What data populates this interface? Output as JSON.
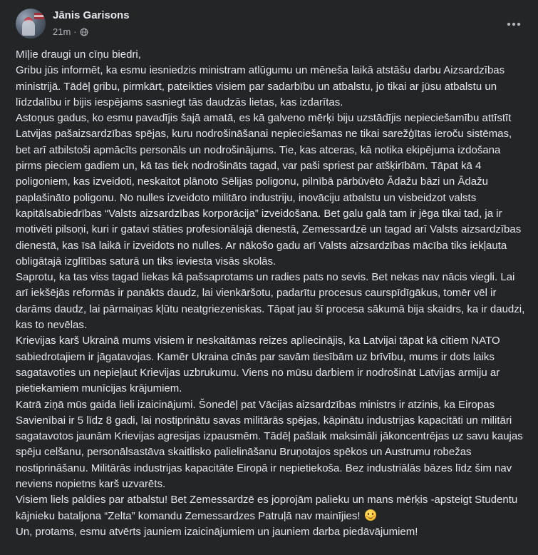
{
  "author": {
    "name": "Jānis Garisons",
    "time": "21m",
    "separator": "·",
    "audience_icon": "globe-icon"
  },
  "menu": {
    "icon": "more-horizontal-icon"
  },
  "post": {
    "lines": [
      "Mīļie draugi un cīņu biedri,",
      "Gribu jūs informēt, ka esmu iesniedzis ministram atlūgumu un mēneša laikā atstāšu darbu Aizsardzības ministrijā. Tādēļ gribu, pirmkārt, pateikties visiem par sadarbību un atbalstu, jo tikai ar jūsu atbalstu un līdzdalību ir bijis iespējams sasniegt tās daudzās lietas, kas izdarītas.",
      "Astoņus gadus, ko esmu pavadījis šajā amatā, es kā galveno mērķi biju uzstādījis nepieciešamību attīstīt Latvijas pašaizsardzības spējas, kuru nodrošināšanai nepieciešamas ne tikai sarežģītas ieroču sistēmas, bet arī atbilstoši apmācīts personāls un nodrošinājums. Tie, kas atceras, kā notika ekipējuma izdošana pirms pieciem gadiem un, kā tas tiek nodrošināts tagad, var paši spriest par atšķirībām. Tāpat kā 4 poligoniem, kas izveidoti, neskaitot plānoto Sēlijas poligonu, pilnībā pārbūvēto Ādažu bāzi un Ādažu paplašināto poligonu. No nulles izveidoto militāro industriju, inovāciju atbalstu un visbeidzot valsts kapitālsabiedrības “Valsts aizsardzības korporācija” izveidošana. Bet galu galā tam ir jēga tikai tad, ja ir motivēti pilsoņi, kuri ir gatavi stāties profesionālajā dienestā, Zemessardzē un tagad arī Valsts aizsardzības dienestā, kas īsā laikā ir izveidots no nulles. Ar nākošo gadu arī Valsts aizsardzības mācība tiks iekļauta obligātajā izglītības saturā un tiks ieviesta visās skolās.",
      "Saprotu, ka tas viss tagad liekas kā pašsaprotams un radies pats no sevis. Bet nekas nav nācis viegli. Lai arī iekšējās reformās ir panākts daudz, lai vienkāršotu, padarītu procesus caurspīdīgākus, tomēr vēl ir darāms daudz, lai pārmaiņas kļūtu neatgriezeniskas. Tāpat jau šī procesa sākumā bija skaidrs, ka ir daudzi, kas to nevēlas.",
      "Krievijas karš Ukrainā mums visiem ir neskaitāmas reizes apliecinājis, ka Latvijai tāpat kā citiem NATO sabiedrotajiem ir jāgatavojas. Kamēr Ukraina cīnās par savām tiesībām uz brīvību, mums ir dots laiks sagatavoties un nepieļaut Krievijas uzbrukumu. Viens no mūsu darbiem ir nodrošināt Latvijas armiju ar pietiekamiem munīcijas krājumiem.",
      "Katrā ziņā mūs gaida lieli izaicinājumi. Šonedēļ pat Vācijas aizsardzības ministrs ir atzinis, ka Eiropas Savienībai ir 5 līdz 8 gadi, lai nostiprinātu savas militārās spējas, kāpinātu industrijas kapacitāti un militāri sagatavotos jaunām Krievijas agresijas izpausmēm. Tādēļ pašlaik maksimāli jākoncentrējas uz savu kaujas spēju celšanu, personālsastāva skaitlisko palielināšanu Bruņotajos spēkos un Austrumu robežas nostiprināšanu. Militārās industrijas kapacitāte Eiropā ir nepietiekoša. Bez industriālās bāzes līdz šim nav neviens nopietns karš uzvarēts.",
      "Visiem liels paldies par atbalstu! Bet Zemessardzē es joprojām palieku un mans mērķis -apsteigt Studentu kājnieku bataljona “Zelta” komandu Zemessardzes Patruļā nav mainījies!",
      "Un, protams, esmu atvērts jauniem izaicinājumiem un jauniem darba piedāvājumiem!"
    ],
    "emoji_icon": "smiling-face-icon"
  }
}
